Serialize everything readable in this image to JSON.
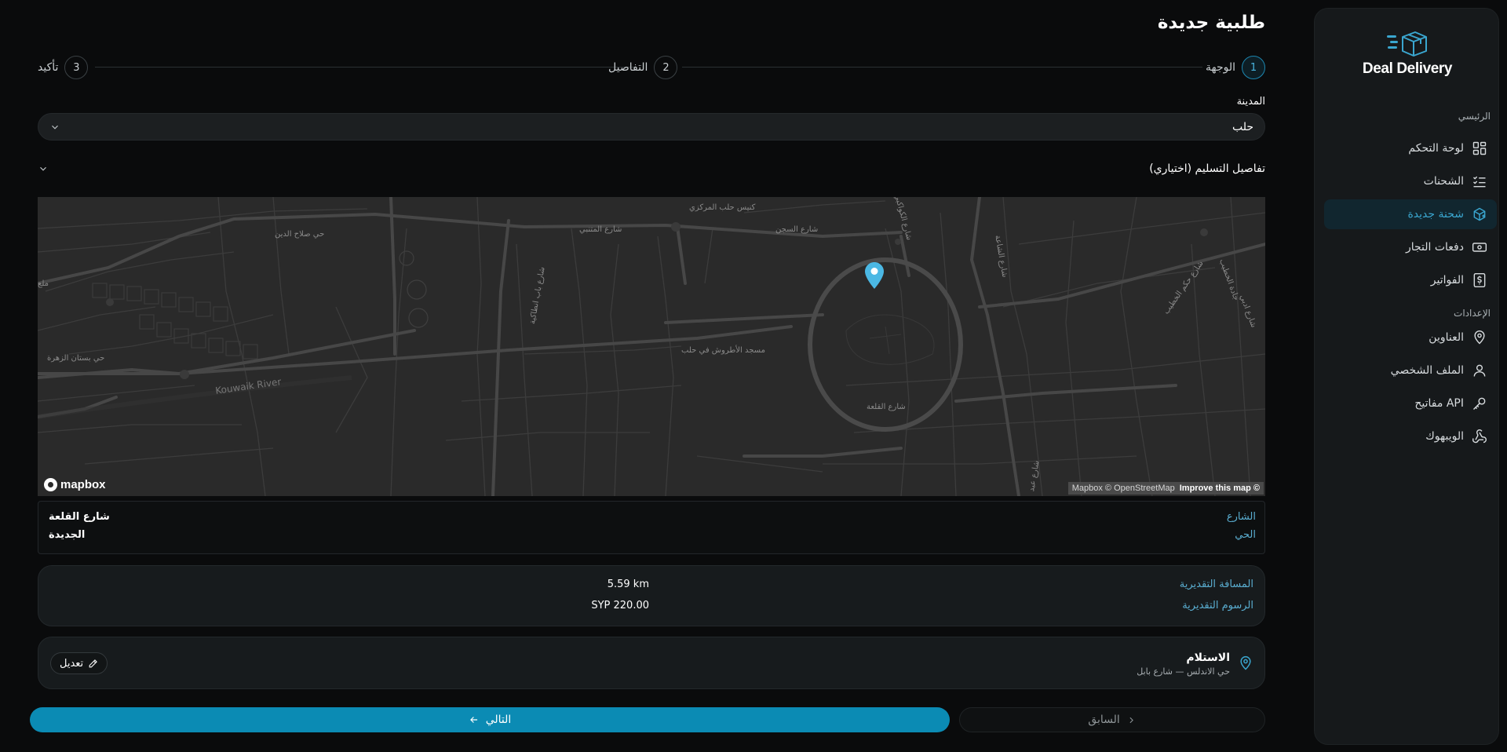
{
  "app": {
    "brand": "Deal Delivery",
    "accent": "#0b8bb4"
  },
  "sidebar": {
    "sections": [
      {
        "title": "الرئيسي"
      },
      {
        "title": "الإعدادات"
      }
    ],
    "items": [
      {
        "label": "لوحة التحكم",
        "icon": "dashboard-icon",
        "active": false
      },
      {
        "label": "الشحنات",
        "icon": "list-check-icon",
        "active": false
      },
      {
        "label": "شحنة جديدة",
        "icon": "package-plus-icon",
        "active": true
      },
      {
        "label": "دفعات التجار",
        "icon": "banknote-icon",
        "active": false
      },
      {
        "label": "الفواتير",
        "icon": "invoice-icon",
        "active": false
      },
      {
        "label": "العناوين",
        "icon": "map-pin-icon",
        "active": false
      },
      {
        "label": "الملف الشخصي",
        "icon": "user-icon",
        "active": false
      },
      {
        "label": "مفاتيح API",
        "icon": "key-icon",
        "active": false
      },
      {
        "label": "الويبهوك",
        "icon": "webhook-icon",
        "active": false
      }
    ]
  },
  "page": {
    "title": "طلبية جديدة"
  },
  "stepper": [
    {
      "num": "1",
      "label": "الوجهة",
      "active": true
    },
    {
      "num": "2",
      "label": "التفاصيل",
      "active": false
    },
    {
      "num": "3",
      "label": "تأكيد",
      "active": false
    }
  ],
  "form": {
    "city_label": "المدينة",
    "city_value": "حلب",
    "delivery_details_label": "تفاصيل التسليم (اختياري)"
  },
  "map": {
    "labels": [
      "كنيس حلب المركزي",
      "حي صلاح الدين",
      "شارع المتنبي",
      "شارع السجن",
      "شارع الكواكبي",
      "شارع باب انطاكية",
      "شارع الشاعة",
      "شارع حكم الخطيب",
      "شارع ادبي",
      "جادة الخطيب",
      "مسجد الأطروش في حلب",
      "حي بستان الزهرة",
      "Kouwaik River",
      "شارع القلعة",
      "شارع عبد",
      "ملع"
    ],
    "logo": "mapbox",
    "attribution": "Mapbox © OpenStreetMap",
    "improve": "Improve this map ©"
  },
  "address": {
    "street_label": "الشارع",
    "street_value": "شارع القلعة",
    "district_label": "الحي",
    "district_value": "الجديدة"
  },
  "estimate": {
    "distance_label": "المسافة التقديرية",
    "distance_value": "5.59 km",
    "fee_label": "الرسوم التقديرية",
    "fee_value": "SYP 220.00"
  },
  "pickup": {
    "title": "الاستلام",
    "subtitle": "حي الاندلس — شارع بابل",
    "edit_label": "تعديل"
  },
  "actions": {
    "next": "التالي",
    "previous": "السابق"
  }
}
